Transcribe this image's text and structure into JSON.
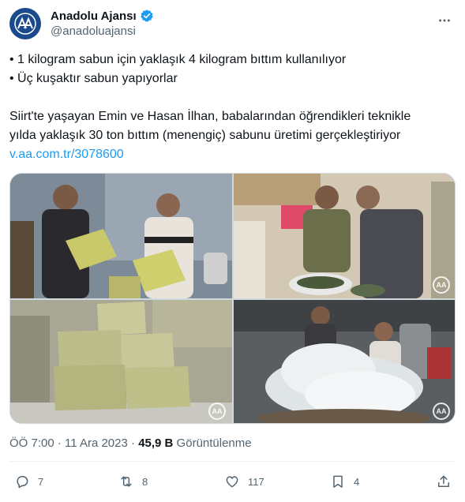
{
  "account": {
    "display_name": "Anadolu Ajansı",
    "handle": "@anadoluajansi",
    "avatar_text": "AA",
    "verified_color": "#1d9bf0"
  },
  "tweet": {
    "bullet1": "• 1 kilogram sabun için yaklaşık 4 kilogram bıttım kullanılıyor",
    "bullet2": "• Üç kuşaktır sabun yapıyorlar",
    "para_line1": "Siirt'te yaşayan Emin ve Hasan İlhan, babalarından öğrendikleri teknikle",
    "para_line2": "yılda yaklaşık 30 ton bıttım (menengiç) sabunu üretimi gerçekleştiriyor",
    "link": "v.aa.com.tr/3078600"
  },
  "media": {
    "watermark": "AA",
    "photos": [
      "photo-1",
      "photo-2",
      "photo-3",
      "photo-4"
    ]
  },
  "meta": {
    "time": "ÖÖ 7:00",
    "sep": " · ",
    "date": "11 Ara 2023",
    "views_count": "45,9 B",
    "views_label": " Görüntülenme"
  },
  "actions": {
    "replies": "7",
    "reposts": "8",
    "likes": "117",
    "bookmarks": "4"
  },
  "colors": {
    "link": "#1d9bf0",
    "secondary_text": "#536471",
    "avatar_bg": "#1a4a8c"
  }
}
